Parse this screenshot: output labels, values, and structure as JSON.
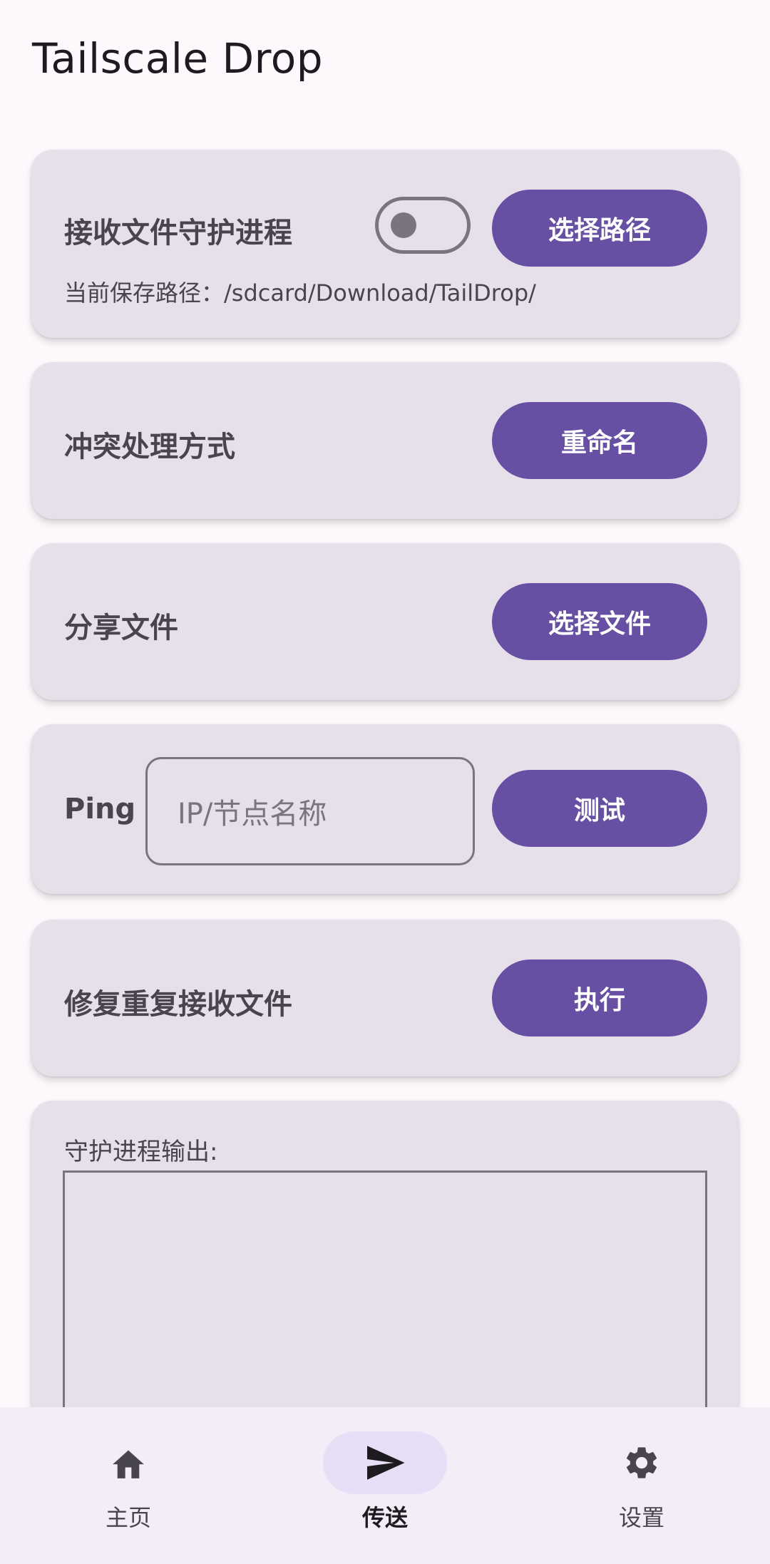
{
  "app": {
    "title": "Tailscale Drop"
  },
  "daemon": {
    "label": "接收文件守护进程",
    "switch_on": false,
    "button": "选择路径",
    "save_path": "当前保存路径：/sdcard/Download/TailDrop/"
  },
  "conflict": {
    "label": "冲突处理方式",
    "button": "重命名"
  },
  "share": {
    "label": "分享文件",
    "button": "选择文件"
  },
  "ping": {
    "label": "Ping",
    "placeholder": "IP/节点名称",
    "button": "测试"
  },
  "repair": {
    "label": "修复重复接收文件",
    "button": "执行"
  },
  "output": {
    "label": "守护进程输出:"
  },
  "nav": {
    "items": [
      {
        "label": "主页",
        "icon": "home-icon",
        "active": false
      },
      {
        "label": "传送",
        "icon": "send-icon",
        "active": true
      },
      {
        "label": "设置",
        "icon": "gear-icon",
        "active": false
      }
    ]
  },
  "colors": {
    "primary": "#6750a4",
    "card": "#e6e0ea",
    "background": "#fdf8fc",
    "nav_background": "#f3edf7",
    "nav_active": "#e8def8"
  }
}
